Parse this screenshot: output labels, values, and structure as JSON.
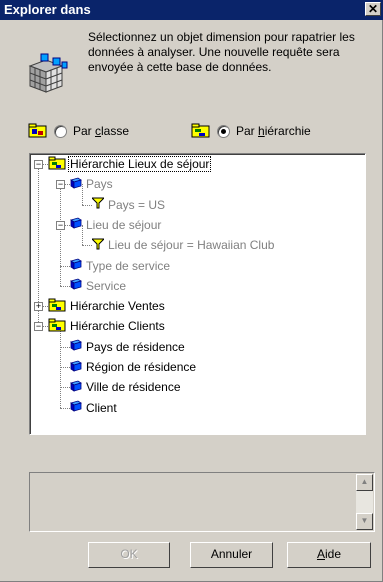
{
  "window": {
    "title": "Explorer dans",
    "close_glyph": "✕"
  },
  "description": "Sélectionnez un objet dimension pour rapatrier les données à analyser. Une nouvelle requête sera envoyée à cette base de données.",
  "radios": {
    "by_class": {
      "prefix": "Par ",
      "underlined": "c",
      "rest": "lasse",
      "checked": false
    },
    "by_hierarchy": {
      "prefix": "Par ",
      "underlined": "h",
      "rest": "iérarchie",
      "checked": true
    }
  },
  "tree": [
    {
      "label": "Hiérarchie Lieux de séjour",
      "icon": "folder-hierarchy-icon",
      "level": 0,
      "expander": "−",
      "greyed": false,
      "focused": true
    },
    {
      "label": "Pays",
      "icon": "dimension-icon",
      "level": 1,
      "expander": "−",
      "greyed": true
    },
    {
      "label": "Pays = US",
      "icon": "filter-icon",
      "level": 2,
      "greyed": true
    },
    {
      "label": "Lieu de séjour",
      "icon": "dimension-icon",
      "level": 1,
      "expander": "−",
      "greyed": true
    },
    {
      "label": "Lieu de séjour = Hawaiian Club",
      "icon": "filter-icon",
      "level": 2,
      "greyed": true
    },
    {
      "label": "Type de service",
      "icon": "dimension-icon",
      "level": 1,
      "greyed": true
    },
    {
      "label": "Service",
      "icon": "dimension-icon",
      "level": 1,
      "greyed": true
    },
    {
      "label": "Hiérarchie Ventes",
      "icon": "folder-hierarchy-icon",
      "level": 0,
      "expander": "+",
      "greyed": false
    },
    {
      "label": "Hiérarchie Clients",
      "icon": "folder-hierarchy-icon",
      "level": 0,
      "expander": "−",
      "greyed": false
    },
    {
      "label": "Pays de résidence",
      "icon": "dimension-icon",
      "level": 1,
      "greyed": false
    },
    {
      "label": "Région de résidence",
      "icon": "dimension-icon",
      "level": 1,
      "greyed": false
    },
    {
      "label": "Ville de résidence",
      "icon": "dimension-icon",
      "level": 1,
      "greyed": false
    },
    {
      "label": "Client",
      "icon": "dimension-icon",
      "level": 1,
      "greyed": false
    }
  ],
  "buttons": {
    "ok": "OK",
    "cancel": "Annuler",
    "help_underlined": "A",
    "help_rest": "ide"
  },
  "scroll": {
    "up_glyph": "▲",
    "down_glyph": "▼"
  },
  "colors": {
    "titlebar": "#0a246a",
    "face": "#d4d0c8",
    "folder_yellow": "#ffff00",
    "dimension_blue": "#0000ff",
    "filter_yellow": "#ffff00"
  }
}
